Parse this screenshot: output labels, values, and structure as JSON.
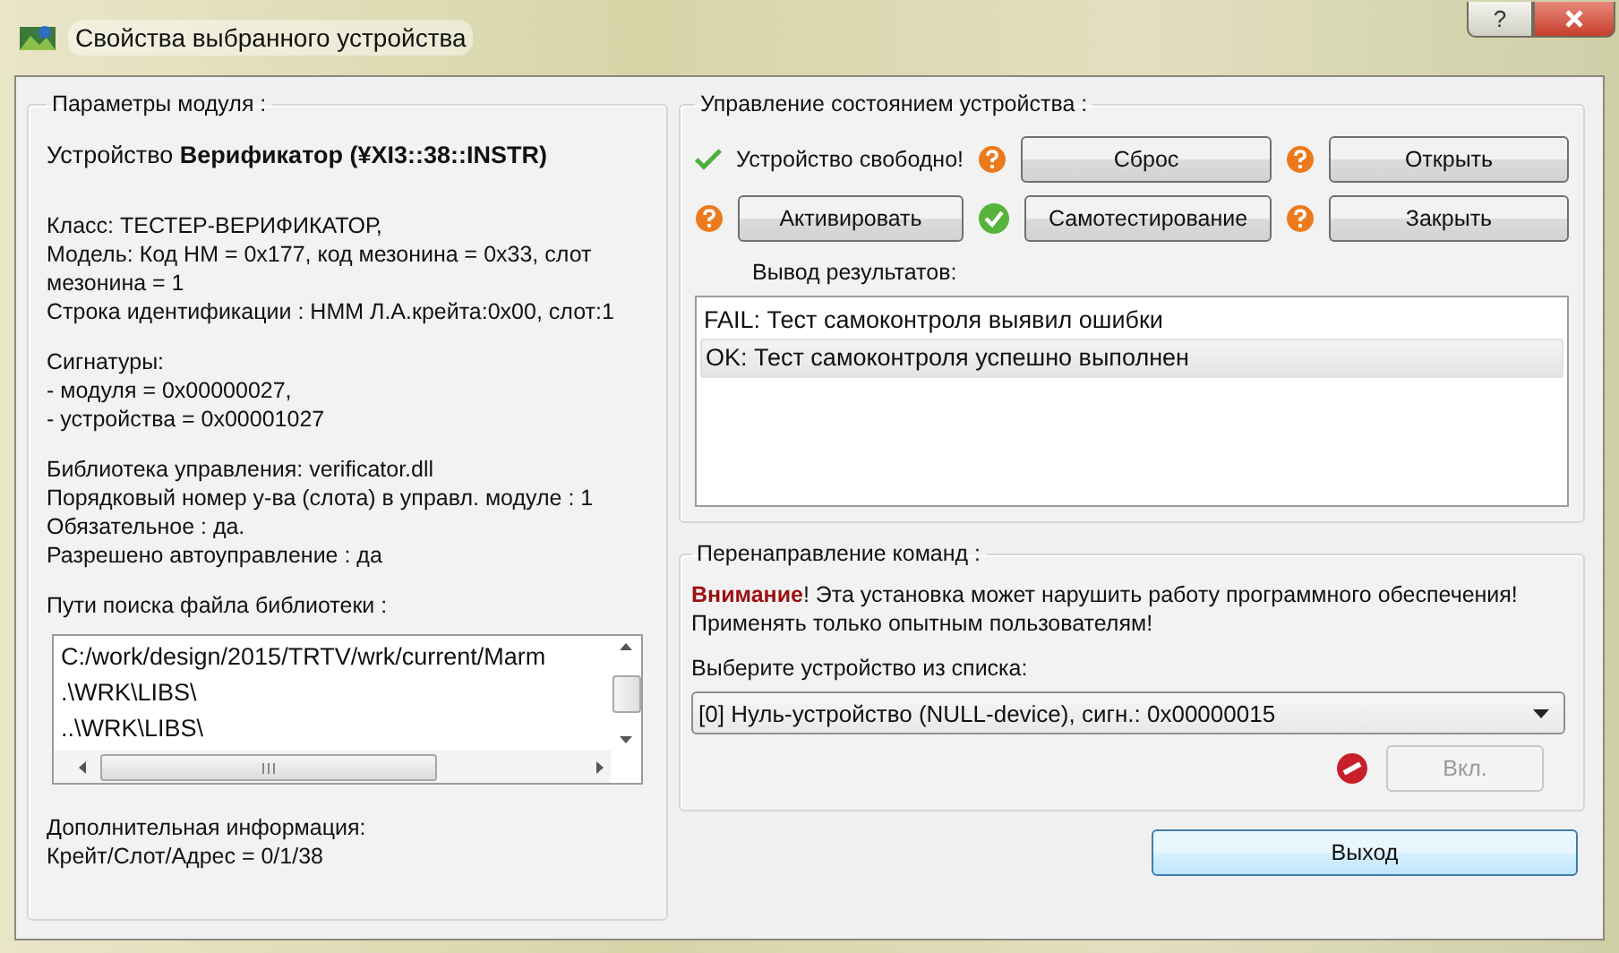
{
  "window": {
    "title": "Свойства выбранного устройства",
    "help_button": "?"
  },
  "module": {
    "title": "Параметры модуля :",
    "device": "Устройство **Верификатор (¥XI3::38::INSTR)**",
    "blocks": [
      [
        "Класс: ТЕСТЕР-ВЕРИФИКАТОР,",
        "Модель: Код НМ = 0x177, код мезонина = 0x33, слот мезонина = 1",
        "Строка идентификации : НММ  Л.А.крейта:0x00, слот:1"
      ],
      [
        "Сигнатуры:",
        " - модуля = 0x00000027,",
        " - устройства = 0x00001027"
      ],
      [
        "Библиотека управления: verificator.dll",
        "Порядковый номер у-ва (слота) в управл. модуле : 1",
        "Обязательное : да.",
        "Разрешено автоуправление : да"
      ]
    ],
    "paths_label": "Пути поиска файла библиотеки :",
    "paths": [
      "C:/work/design/2015/TRTV/wrk/current/Marm",
      ".\\WRK\\LIBS\\",
      "..\\WRK\\LIBS\\"
    ],
    "extra": [
      "Дополнительная информация:",
      "Крейт/Слот/Адрес = 0/1/38"
    ]
  },
  "control": {
    "title": "Управление состоянием устройства :",
    "rows": [
      [
        {
          "kind": "status",
          "text": "Устройство свободно!"
        },
        {
          "kind": "button",
          "ok": false,
          "label": "Сброс"
        },
        {
          "kind": "button",
          "ok": false,
          "label": "Открыть"
        }
      ],
      [
        {
          "kind": "button",
          "ok": false,
          "label": "Активировать"
        },
        {
          "kind": "button",
          "ok": true,
          "label": "Самотестирование"
        },
        {
          "kind": "button",
          "ok": false,
          "label": "Закрыть"
        }
      ]
    ],
    "results_label": "Вывод результатов:",
    "results": [
      {
        "text": "FAIL: Тест самоконтроля выявил ошибки",
        "selected": false
      },
      {
        "text": "OK: Тест самоконтроля успешно выполнен",
        "selected": true
      }
    ]
  },
  "redirect": {
    "title": "Перенаправление команд :",
    "warning": "**Внимание**! Эта установка может нарушить работу программного обеспечения! Применять только опытным пользователям!",
    "select_label": "Выберите устройство из списка:",
    "select_value": "[0] Нуль-устройство (NULL-device), сигн.: 0x00000015",
    "enable_button": {
      "label": "Вкл.",
      "disabled": true
    }
  },
  "exit_button": "Выход"
}
